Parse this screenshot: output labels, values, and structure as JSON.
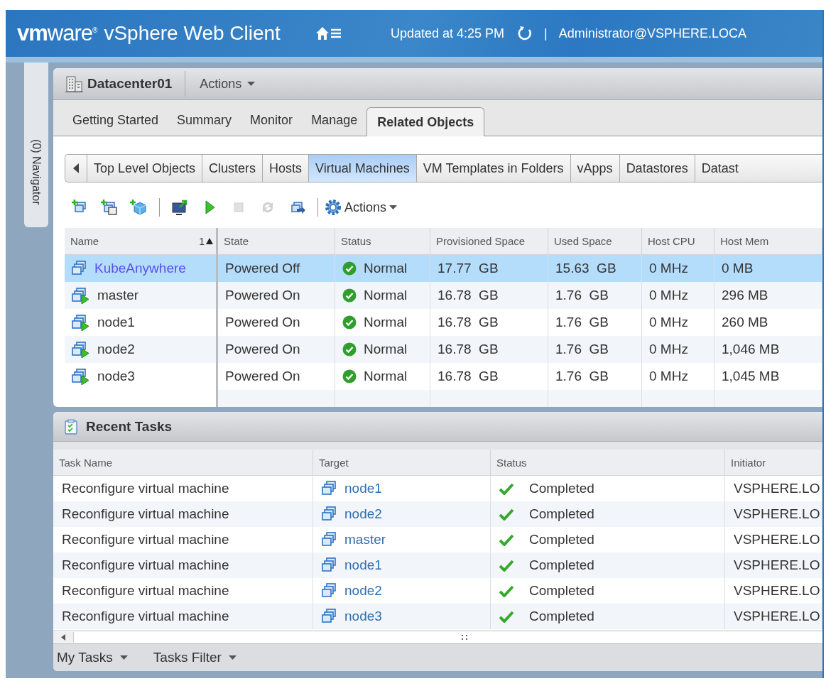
{
  "header": {
    "logo": "**vm**ware$^{®}$",
    "product": "vSphere Web Client",
    "updated": "Updated at 4:25 PM",
    "separator": "|",
    "user": "Administrator@VSPHERE.LOCA"
  },
  "navigator": {
    "label": "(0) Navigator"
  },
  "object": {
    "title": "Datacenter01",
    "actions": "Actions"
  },
  "tabs": [
    {
      "label": "Getting Started",
      "selected": false
    },
    {
      "label": "Summary",
      "selected": false
    },
    {
      "label": "Monitor",
      "selected": false
    },
    {
      "label": "Manage",
      "selected": false
    },
    {
      "label": "Related Objects",
      "selected": true
    }
  ],
  "subtabs": [
    {
      "label": "Top Level Objects",
      "selected": false
    },
    {
      "label": "Clusters",
      "selected": false
    },
    {
      "label": "Hosts",
      "selected": false
    },
    {
      "label": "Virtual Machines",
      "selected": true
    },
    {
      "label": "VM Templates in Folders",
      "selected": false
    },
    {
      "label": "vApps",
      "selected": false
    },
    {
      "label": "Datastores",
      "selected": false
    },
    {
      "label": "Datast",
      "selected": false
    }
  ],
  "toolbar": {
    "buttons": [
      {
        "kind": "new-vm",
        "disabled": false
      },
      {
        "kind": "clone",
        "disabled": false
      },
      {
        "kind": "new-vapp",
        "disabled": false
      },
      {
        "kind": "sep"
      },
      {
        "kind": "console",
        "disabled": false
      },
      {
        "kind": "power-on",
        "disabled": false
      },
      {
        "kind": "stop",
        "disabled": true
      },
      {
        "kind": "reset",
        "disabled": true
      },
      {
        "kind": "migrate",
        "disabled": false
      },
      {
        "kind": "sep"
      }
    ],
    "actions": "Actions"
  },
  "vm_table": {
    "columns": [
      "Name",
      "State",
      "Status",
      "Provisioned Space",
      "Used Space",
      "Host CPU",
      "Host Mem"
    ],
    "sort_order": "1",
    "rows": [
      {
        "name": "KubeAnywhere",
        "running": false,
        "selected": true,
        "state": "Powered Off",
        "status": "Normal",
        "provisioned": "17.77  GB",
        "used": "15.63  GB",
        "cpu": "0 MHz",
        "mem": "0 MB"
      },
      {
        "name": "master",
        "running": true,
        "selected": false,
        "state": "Powered On",
        "status": "Normal",
        "provisioned": "16.78  GB",
        "used": "1.76  GB",
        "cpu": "0 MHz",
        "mem": "296 MB"
      },
      {
        "name": "node1",
        "running": true,
        "selected": false,
        "state": "Powered On",
        "status": "Normal",
        "provisioned": "16.78  GB",
        "used": "1.76  GB",
        "cpu": "0 MHz",
        "mem": "260 MB"
      },
      {
        "name": "node2",
        "running": true,
        "selected": false,
        "state": "Powered On",
        "status": "Normal",
        "provisioned": "16.78  GB",
        "used": "1.76  GB",
        "cpu": "0 MHz",
        "mem": "1,046 MB"
      },
      {
        "name": "node3",
        "running": true,
        "selected": false,
        "state": "Powered On",
        "status": "Normal",
        "provisioned": "16.78  GB",
        "used": "1.76  GB",
        "cpu": "0 MHz",
        "mem": "1,045 MB"
      }
    ]
  },
  "recent_tasks": {
    "title": "Recent Tasks",
    "columns": [
      "Task Name",
      "Target",
      "Status",
      "Initiator"
    ],
    "rows": [
      {
        "task": "Reconfigure virtual machine",
        "target": "node1",
        "status": "Completed",
        "initiator": "VSPHERE.LO"
      },
      {
        "task": "Reconfigure virtual machine",
        "target": "node2",
        "status": "Completed",
        "initiator": "VSPHERE.LO"
      },
      {
        "task": "Reconfigure virtual machine",
        "target": "master",
        "status": "Completed",
        "initiator": "VSPHERE.LO"
      },
      {
        "task": "Reconfigure virtual machine",
        "target": "node1",
        "status": "Completed",
        "initiator": "VSPHERE.LO"
      },
      {
        "task": "Reconfigure virtual machine",
        "target": "node2",
        "status": "Completed",
        "initiator": "VSPHERE.LO"
      },
      {
        "task": "Reconfigure virtual machine",
        "target": "node3",
        "status": "Completed",
        "initiator": "VSPHERE.LO"
      }
    ],
    "footer": [
      "My Tasks",
      "Tasks Filter"
    ]
  }
}
